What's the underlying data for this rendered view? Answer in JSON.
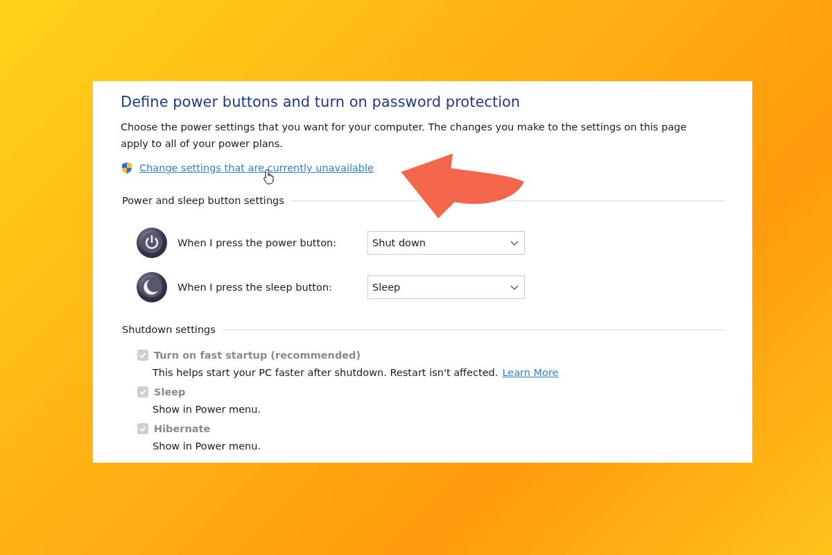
{
  "heading": "Define power buttons and turn on password protection",
  "description": "Choose the power settings that you want for your computer. The changes you make to the settings on this page apply to all of your power plans.",
  "admin_link": "Change settings that are currently unavailable",
  "button_settings": {
    "title": "Power and sleep button settings",
    "rows": [
      {
        "kind": "power",
        "label": "When I press the power button:",
        "value": "Shut down"
      },
      {
        "kind": "sleep",
        "label": "When I press the sleep button:",
        "value": "Sleep"
      }
    ]
  },
  "shutdown_settings": {
    "title": "Shutdown settings",
    "options": [
      {
        "label": "Turn on fast startup (recommended)",
        "checked": true,
        "disabled": true,
        "description": "This helps start your PC faster after shutdown. Restart isn't affected.",
        "link": "Learn More"
      },
      {
        "label": "Sleep",
        "checked": true,
        "disabled": true,
        "description": "Show in Power menu."
      },
      {
        "label": "Hibernate",
        "checked": true,
        "disabled": true,
        "description": "Show in Power menu."
      }
    ]
  }
}
